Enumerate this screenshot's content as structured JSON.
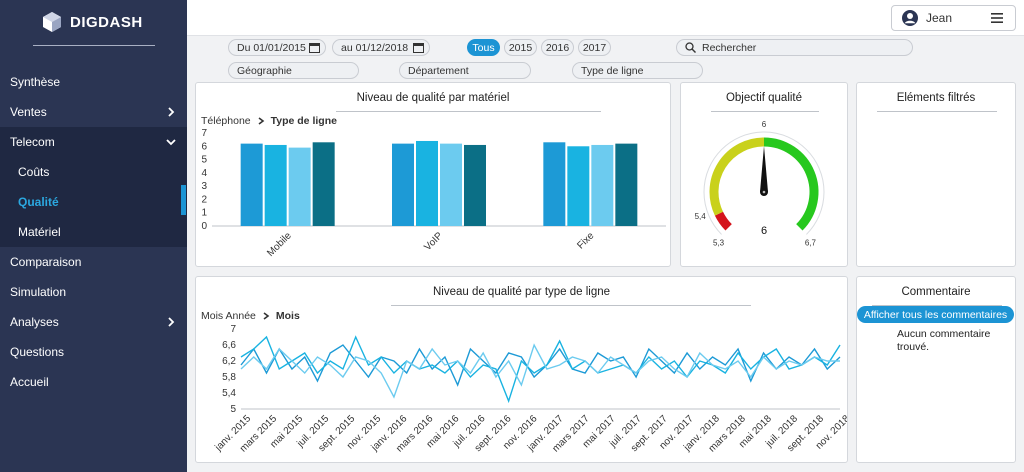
{
  "app": {
    "logo_text": "DIGDASH"
  },
  "sidebar": {
    "items": [
      {
        "label": "Synthèse"
      },
      {
        "label": "Ventes"
      },
      {
        "label": "Telecom"
      },
      {
        "label": "Coûts"
      },
      {
        "label": "Qualité"
      },
      {
        "label": "Matériel"
      },
      {
        "label": "Comparaison"
      },
      {
        "label": "Simulation"
      },
      {
        "label": "Analyses"
      },
      {
        "label": "Questions"
      },
      {
        "label": "Accueil"
      }
    ]
  },
  "topbar": {
    "user_name": "Jean"
  },
  "filters": {
    "date_from": "Du 01/01/2015",
    "date_to": "au 01/12/2018",
    "years": [
      "Tous",
      "2015",
      "2016",
      "2017"
    ],
    "selected_year": "Tous",
    "search_placeholder": "Rechercher",
    "dimensions": [
      "Géographie",
      "Département",
      "Type de ligne"
    ]
  },
  "panels": {
    "bar_title": "Niveau de qualité par matériel",
    "bar_breadcrumb": [
      "Téléphone",
      "Type de ligne"
    ],
    "gauge_title": "Objectif qualité",
    "filtered_title": "Eléments filtrés",
    "line_title": "Niveau de qualité par type de ligne",
    "line_breadcrumb": [
      "Mois Année",
      "Mois"
    ],
    "comment_title": "Commentaire",
    "comment_button": "Afficher tous les commentaires",
    "comment_empty": "Aucun commentaire trouvé."
  },
  "colors": {
    "sidebar_bg": "#2b3553",
    "accent": "#1c94d4",
    "bar_colors": [
      "#1d9ad6",
      "#19b3e1",
      "#6ccbef",
      "#0b6f86"
    ],
    "gauge_red": "#d4141c",
    "gauge_yellow": "#c9d11b",
    "gauge_green": "#27c81e"
  },
  "chart_data": [
    {
      "type": "bar",
      "title": "Niveau de qualité par matériel",
      "categories": [
        "Mobile",
        "VoIP",
        "Fixe"
      ],
      "series": [
        {
          "values": [
            6.2,
            6.2,
            6.3
          ]
        },
        {
          "values": [
            6.1,
            6.4,
            6.0
          ]
        },
        {
          "values": [
            5.9,
            6.2,
            6.1
          ]
        },
        {
          "values": [
            6.3,
            6.1,
            6.2
          ]
        }
      ],
      "y_ticks": [
        "0",
        "1",
        "2",
        "3",
        "4",
        "5",
        "6",
        "7"
      ],
      "ylim": [
        0,
        7
      ]
    },
    {
      "type": "gauge",
      "title": "Objectif qualité",
      "min": 5.3,
      "max": 6.7,
      "value": 6,
      "value_label": "6",
      "target_label": "6",
      "min_label": "5,3",
      "max_label": "6,7",
      "red_end_label": "5,4",
      "bands": [
        {
          "from": 5.3,
          "to": 5.4,
          "color": "#d4141c"
        },
        {
          "from": 5.4,
          "to": 6.0,
          "color": "#c9d11b"
        },
        {
          "from": 6.0,
          "to": 6.7,
          "color": "#27c81e"
        }
      ]
    },
    {
      "type": "line",
      "title": "Niveau de qualité par type de ligne",
      "x_labels": [
        "janv. 2015",
        "mars 2015",
        "mai 2015",
        "juil. 2015",
        "sept. 2015",
        "nov. 2015",
        "janv. 2016",
        "mars 2016",
        "mai 2016",
        "juil. 2016",
        "sept. 2016",
        "nov. 2016",
        "janv. 2017",
        "mars 2017",
        "mai 2017",
        "juil. 2017",
        "sept. 2017",
        "nov. 2017",
        "janv. 2018",
        "mars 2018",
        "mai 2018",
        "juil. 2018",
        "sept. 2018",
        "nov. 2018"
      ],
      "y_ticks": [
        "5",
        "5,4",
        "5,8",
        "6,2",
        "6,6",
        "7"
      ],
      "ylim": [
        5,
        7
      ],
      "series": [
        {
          "color": "#1d9ad6",
          "values": [
            6.1,
            6.5,
            5.9,
            6.5,
            6.0,
            6.3,
            5.7,
            6.4,
            6.6,
            6.2,
            5.8,
            6.3,
            6.2,
            5.9,
            6.5,
            6.0,
            6.3,
            5.6,
            6.5,
            6.2,
            5.9,
            6.4,
            6.3,
            5.8,
            6.1,
            6.5,
            6.0,
            5.9,
            6.4,
            6.2,
            6.3,
            5.8,
            6.5,
            6.2,
            5.9,
            6.4,
            6.0,
            6.3,
            6.1,
            6.5,
            5.7,
            6.4,
            6.0,
            6.3,
            6.1,
            6.5,
            6.0,
            6.3
          ]
        },
        {
          "color": "#19b3e1",
          "values": [
            6.3,
            6.5,
            6.8,
            6.0,
            6.2,
            6.4,
            5.9,
            6.2,
            6.0,
            6.8,
            6.1,
            6.3,
            5.9,
            6.2,
            6.0,
            6.1,
            5.9,
            6.2,
            5.8,
            6.1,
            6.0,
            5.2,
            6.2,
            5.9,
            6.1,
            6.7,
            6.0,
            6.2,
            5.9,
            6.0,
            6.1,
            5.9,
            6.3,
            6.0,
            6.2,
            5.8,
            6.2,
            6.1,
            5.9,
            6.4,
            6.0,
            6.3,
            6.5,
            6.0,
            6.1,
            6.3,
            6.1,
            6.6
          ]
        },
        {
          "color": "#6ccbef",
          "values": [
            6.0,
            6.3,
            6.0,
            6.5,
            6.2,
            5.9,
            6.3,
            6.1,
            5.8,
            6.3,
            6.2,
            5.9,
            5.3,
            6.2,
            6.0,
            6.5,
            6.1,
            6.2,
            5.9,
            6.4,
            5.8,
            6.2,
            5.6,
            6.6,
            6.0,
            6.1,
            6.3,
            6.2,
            5.9,
            6.3,
            6.1,
            5.9,
            6.2,
            6.3,
            6.0,
            5.8,
            6.4,
            6.1,
            6.0,
            6.2,
            5.8,
            6.3,
            6.0,
            6.2,
            6.1,
            6.3,
            6.2,
            6.2
          ]
        }
      ]
    }
  ]
}
